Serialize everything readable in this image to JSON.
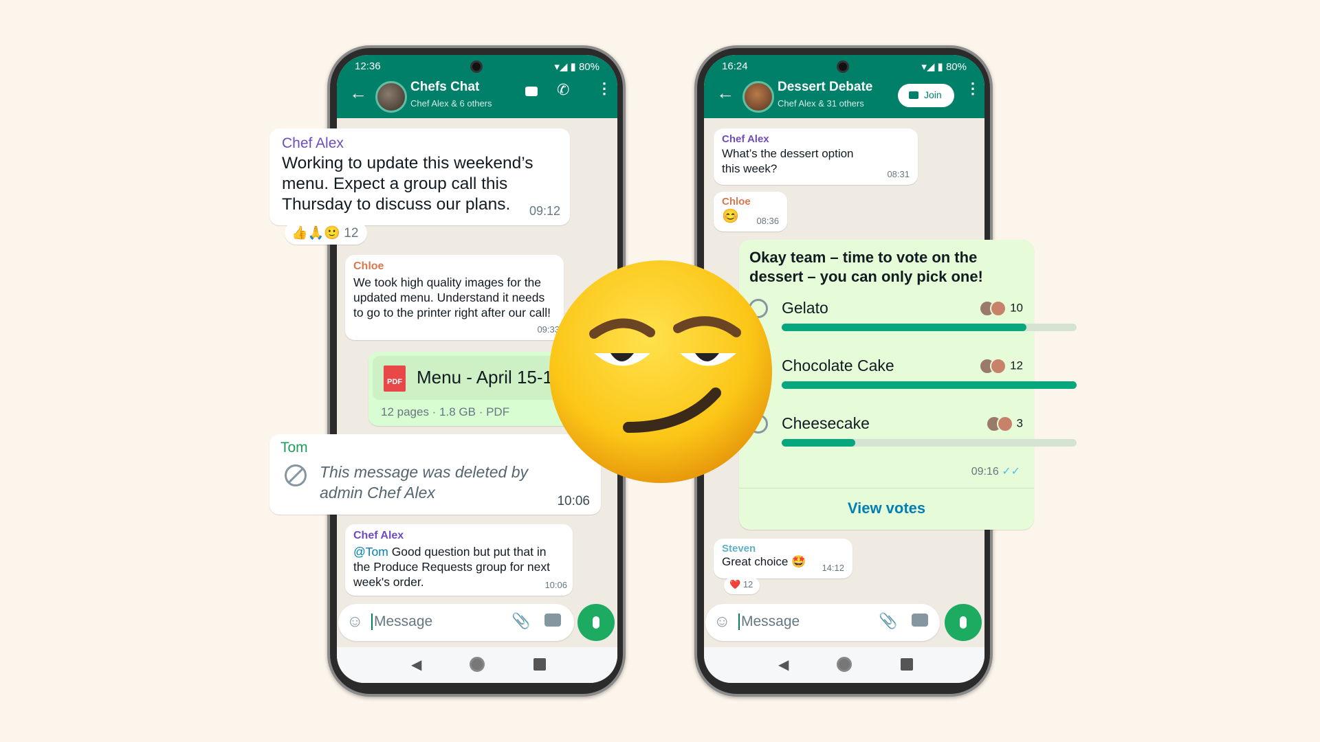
{
  "left_phone": {
    "status": {
      "time": "12:36",
      "battery": "80%"
    },
    "header": {
      "title": "Chefs Chat",
      "subtitle": "Chef Alex & 6 others"
    },
    "messages": [
      {
        "sender": "Chef Alex",
        "text": "Working to update this weekend’s menu. Expect a group call this Thursday to discuss our plans.",
        "time": "09:12",
        "reactions": "👍🙏🙂",
        "reaction_count": "12"
      },
      {
        "sender": "Chloe",
        "text": "We took high quality images for the updated menu. Understand it needs to go to the printer right after our call!",
        "time": "09:33"
      },
      {
        "file_name": "Menu - April 15-17",
        "file_icon": "PDF",
        "file_meta": "12 pages · 1.8 GB · PDF"
      },
      {
        "sender": "Tom",
        "text": "This message was deleted by admin Chef Alex",
        "time": "10:06"
      },
      {
        "sender": "Chef Alex",
        "mention": "@Tom",
        "text": " Good question but put that in the Produce Requests group for next week's order.",
        "time": "10:06"
      }
    ],
    "input": {
      "placeholder": "Message"
    }
  },
  "right_phone": {
    "status": {
      "time": "16:24",
      "battery": "80%"
    },
    "header": {
      "title": "Dessert Debate",
      "subtitle": "Chef Alex & 31 others",
      "join_label": "Join"
    },
    "messages": [
      {
        "sender": "Chef Alex",
        "text": "What’s the dessert option this week?",
        "time": "08:31"
      },
      {
        "sender": "Chloe",
        "text": "😊",
        "time": "08:36"
      },
      {
        "sender": "Steven",
        "text": "Great choice 🤩",
        "time": "14:12",
        "reactions": "❤️",
        "reaction_count": "12"
      }
    ],
    "poll": {
      "question": "Okay team – time to vote on the dessert – you can only pick one!",
      "options": [
        {
          "label": "Gelato",
          "votes": "10",
          "fraction": 0.83
        },
        {
          "label": "Chocolate Cake",
          "votes": "12",
          "fraction": 1.0
        },
        {
          "label": "Cheesecake",
          "votes": "3",
          "fraction": 0.25
        }
      ],
      "time": "09:16",
      "view_votes": "View votes"
    },
    "input": {
      "placeholder": "Message"
    }
  },
  "colors": {
    "header": "#008069",
    "accent": "#1daa61",
    "bar": "#06a77d",
    "poll_bg": "#e6fbd8",
    "background": "#fcf5eb"
  }
}
